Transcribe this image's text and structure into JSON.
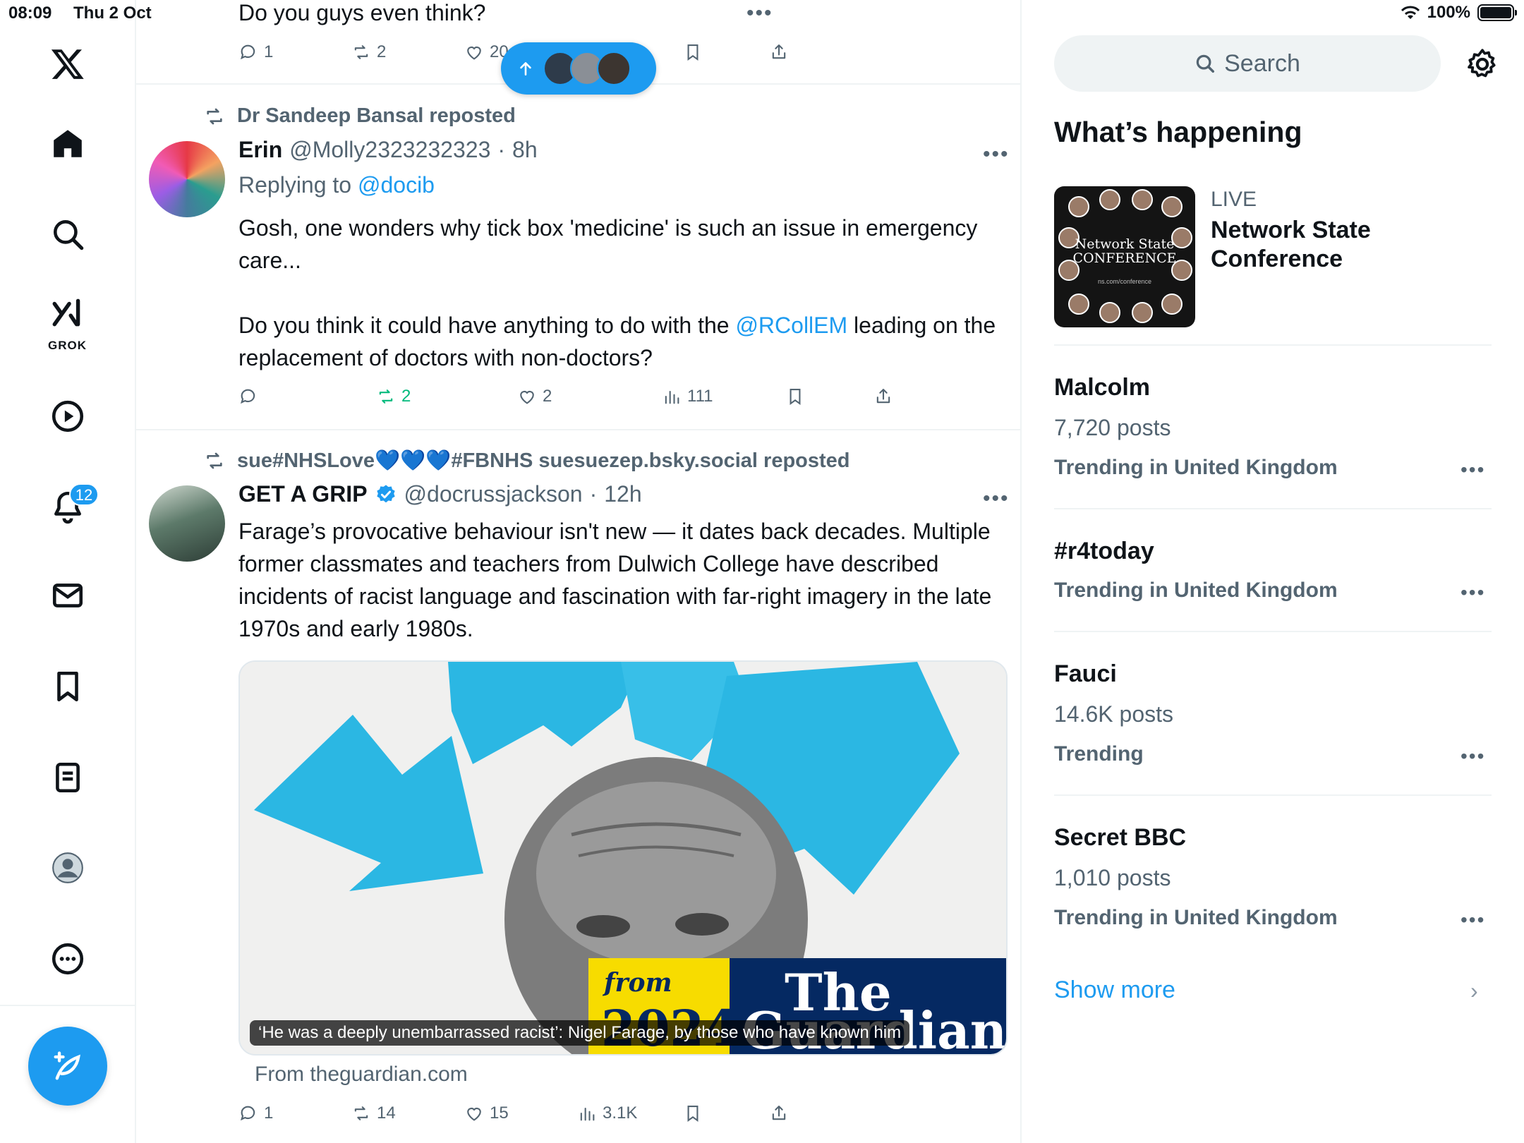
{
  "status_bar": {
    "time": "08:09",
    "date": "Thu 2 Oct",
    "battery": "100%"
  },
  "nav": {
    "items": [
      {
        "name": "x-logo-icon"
      },
      {
        "name": "home-icon"
      },
      {
        "name": "search-icon"
      },
      {
        "name": "grok-icon"
      },
      {
        "name": "video-icon"
      },
      {
        "name": "bell-icon"
      },
      {
        "name": "mail-icon"
      },
      {
        "name": "bookmark-icon"
      },
      {
        "name": "lists-icon"
      },
      {
        "name": "profile-icon"
      },
      {
        "name": "more-icon"
      }
    ],
    "grok_label": "GROK",
    "notifications_badge": "12",
    "accent_color": "#1d9bf0"
  },
  "timeline": {
    "top_post": {
      "text": "Do you guys even think?",
      "replies": "1",
      "reposts": "2",
      "likes": "20"
    },
    "new_posts_pill": {
      "icon": "arrow-up-icon"
    },
    "post1": {
      "repost_by": "Dr Sandeep Bansal reposted",
      "name": "Erin",
      "handle": "@Molly2323232323",
      "sep": "·",
      "time": "8h",
      "replying_prefix": "Replying to",
      "replying_to": "@docib",
      "text_line1": "Gosh, one wonders why tick box 'medicine' is such an issue in emergency care...",
      "text_line2_a": "Do you think it could have anything to do with the",
      "text_line2_mention": "@RCollEM",
      "text_line2_b": "leading on the replacement of doctors with non-doctors?",
      "reposts": "2",
      "likes": "2",
      "views": "111"
    },
    "post2": {
      "repost_by": "sue#NHSLove💙💙💙#FBNHS suesuezep.bsky.social reposted",
      "name": "GET A GRIP",
      "handle": "@docrussjackson",
      "sep": "·",
      "time": "12h",
      "text": "Farage’s provocative behaviour isn't new — it dates back decades. Multiple former classmates and teachers from Dulwich College have described incidents of racist language and fascination with far-right imagery in the late 1970s and early 1980s.",
      "media_caption": "‘He was a deeply unembarrassed racist’: Nigel Farage, by those who have known him",
      "media_from_word": "from",
      "media_year": "2024",
      "media_brand_the": "The",
      "media_brand_name": "Guardian",
      "link_source": "From theguardian.com",
      "replies": "1",
      "reposts": "14",
      "likes": "15",
      "views": "3.1K"
    }
  },
  "sidebar": {
    "search_placeholder": "Search",
    "section_title": "What’s happening",
    "live": {
      "label": "LIVE",
      "title": "Network State Conference",
      "thumb_title": "Network State CONFERENCE",
      "thumb_url": "ns.com/conference"
    },
    "trends": [
      {
        "title": "Malcolm",
        "posts": "7,720 posts",
        "context": "Trending in United Kingdom"
      },
      {
        "title": "#r4today",
        "posts": "",
        "context": "Trending in United Kingdom"
      },
      {
        "title": "Fauci",
        "posts": "14.6K posts",
        "context": "Trending"
      },
      {
        "title": "Secret BBC",
        "posts": "1,010 posts",
        "context": "Trending in United Kingdom"
      }
    ],
    "more_dots": "•••",
    "show_more": "Show more",
    "chevron": "›"
  }
}
